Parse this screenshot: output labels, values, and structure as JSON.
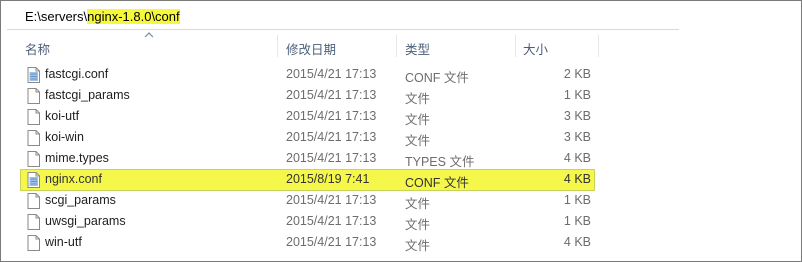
{
  "address": {
    "prefix": "E:\\servers\\",
    "highlighted": "nginx-1.8.0\\conf"
  },
  "columns": {
    "name": "名称",
    "date": "修改日期",
    "type": "类型",
    "size": "大小"
  },
  "files": [
    {
      "name": "fastcgi.conf",
      "date": "2015/4/21 17:13",
      "type": "CONF 文件",
      "size": "2 KB",
      "icon": "conf-file-icon"
    },
    {
      "name": "fastcgi_params",
      "date": "2015/4/21 17:13",
      "type": "文件",
      "size": "1 KB",
      "icon": "blank-file-icon"
    },
    {
      "name": "koi-utf",
      "date": "2015/4/21 17:13",
      "type": "文件",
      "size": "3 KB",
      "icon": "blank-file-icon"
    },
    {
      "name": "koi-win",
      "date": "2015/4/21 17:13",
      "type": "文件",
      "size": "3 KB",
      "icon": "blank-file-icon"
    },
    {
      "name": "mime.types",
      "date": "2015/4/21 17:13",
      "type": "TYPES 文件",
      "size": "4 KB",
      "icon": "blank-file-icon"
    },
    {
      "name": "nginx.conf",
      "date": "2015/8/19 7:41",
      "type": "CONF 文件",
      "size": "4 KB",
      "icon": "conf-file-icon",
      "selected": true
    },
    {
      "name": "scgi_params",
      "date": "2015/4/21 17:13",
      "type": "文件",
      "size": "1 KB",
      "icon": "blank-file-icon"
    },
    {
      "name": "uwsgi_params",
      "date": "2015/4/21 17:13",
      "type": "文件",
      "size": "1 KB",
      "icon": "blank-file-icon"
    },
    {
      "name": "win-utf",
      "date": "2015/4/21 17:13",
      "type": "文件",
      "size": "4 KB",
      "icon": "blank-file-icon"
    }
  ],
  "colors": {
    "highlight": "#f5f74a",
    "header_text": "#4c607a",
    "secondary_text": "#6d6d6d"
  }
}
